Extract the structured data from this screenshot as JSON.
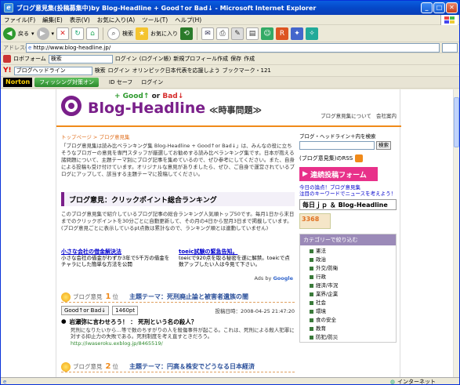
{
  "window": {
    "title": "ブログ意見集(投稿募集中)by Blog-Headline + Good↑or Bad↓ - Microsoft Internet Explorer"
  },
  "menu": [
    "ファイル(F)",
    "編集(E)",
    "表示(V)",
    "お気に入り(A)",
    "ツール(T)",
    "ヘルプ(H)"
  ],
  "toolbar": {
    "back": "戻る",
    "search": "検索",
    "favorites": "お気に入り"
  },
  "address": {
    "label": "アドレス(D)",
    "url": "http://www.blog-headline.jp/"
  },
  "links_bar": {
    "bookmark_label": "ロボフォーム",
    "search_label": "検索",
    "login": "ログイン",
    "login_cache": "(ログイン帳)",
    "new_profile": "新規プロフィール作成",
    "save": "保存",
    "make": "作成"
  },
  "yahoo_bar": {
    "box_label": "ブログヘッドライン",
    "search": "検索",
    "login": "ログイン",
    "olympic": "オリンピック日本代表を応援しよう",
    "bookmark": "ブックマーク・121"
  },
  "norton_bar": {
    "brand": "Norton",
    "phishing": "フィッシング対策オン",
    "id_safe": "ID セーフ",
    "login": "ログイン"
  },
  "status": {
    "zone": "インターネット"
  },
  "site": {
    "good": "+ Good",
    "good_arrow": "↑",
    "or": "or",
    "bad": "Bad",
    "bad_arrow": "↓",
    "logo_text": "Blog-Headline",
    "subtitle": "≪時事問題≫",
    "links": [
      "ブログ意見集について",
      "会社案内"
    ],
    "breadcrumb": "トップページ > ブログ意見集",
    "intro": "「ブログ意見集は読み比べランキング集 Blog-Headline + Good↑or Bad↓」は、みんなの役に立ちそうなブロガーの意見を専門スタッフが厳選してお勧めする読み比べランキング集です。日本が抱える諸問題について、主題テーマ別にブログ記事を集めているので、ぜひ参考にしてください。また、自身による投稿も受け付けています。オリジナルな意見がありましたら、ぜひ、ご自身で運営されているブログにアップして、該当する主題テーマに投稿してください。",
    "rank_title": "ブログ意見：クリックポイント総合ランキング",
    "rank_desc": "このブログ意見集で紹介しているブログ記事の総合ランキング人気順トップ50です。毎月1日から末日までのクリックポイントを30分ごとに自動更新して、その月の4日から翌月3日まで掲載しています。(ブログ意見ごとに表示しているpt点数は累計なので、ランキング順とは連動していません)",
    "ads": [
      {
        "title": "小さな会社の借金解決法",
        "text": "小さな会社の借金がわずか3年で5千万の借金を チャラにした簡単な方法を公開"
      },
      {
        "title": "toeic試験の緊急告知。",
        "text": "toeicで920点を取る秘密を遂に解禁。toeicで点数アップしたい人は今見て下さい。"
      }
    ],
    "ads_by": "Ads by",
    "ads_brand": "Google",
    "entries": [
      {
        "rank_label": "ブログ意見",
        "rank_no": "1",
        "rank_unit": "位",
        "theme": "主題テーマ：死刑廃止論と被害者遺族の闇",
        "btn": "Good↑or Bad↓",
        "count": "1460pt",
        "date": "投稿日時：2008-04-25 21:47:20",
        "title": "岩瀬弥に言わせろう！ ： 死刑という名の殺人？",
        "text": "死刑になりたいから…等で数のちすがりの人を殺傷事件が起こる。これは、死刑による殺人犯罪に対する抑止力の失敗である。死刑制度を考え直すときだろう。",
        "url": "http://iwaseroku.exblog.jp/8465519/"
      },
      {
        "rank_label": "ブログ意見",
        "rank_no": "2",
        "rank_unit": "位",
        "theme": "主題テーマ：円高＆株安でどうなる日本経済"
      }
    ],
    "side": {
      "search_label": "ブログ・ヘッドライン＋内を検索",
      "search_button": "検索",
      "rss": "(ブログ意見集)のRSS",
      "post_button": "連続投稿フォーム",
      "news_line1": "今日の論点！ブログ意見集",
      "news_line2": "注目のキーワードでニュースを考えよう！",
      "mainichi": "毎日ｊｐ ＆ Blog-Headline",
      "counter": "3368",
      "cat_header": "カテゴリーで絞り込む",
      "categories": [
        "憲法",
        "政治",
        "外交/防衛",
        "行政",
        "経済/市況",
        "業界/企業",
        "社会",
        "環境",
        "食の安全",
        "教育",
        "防犯/防災"
      ]
    }
  }
}
